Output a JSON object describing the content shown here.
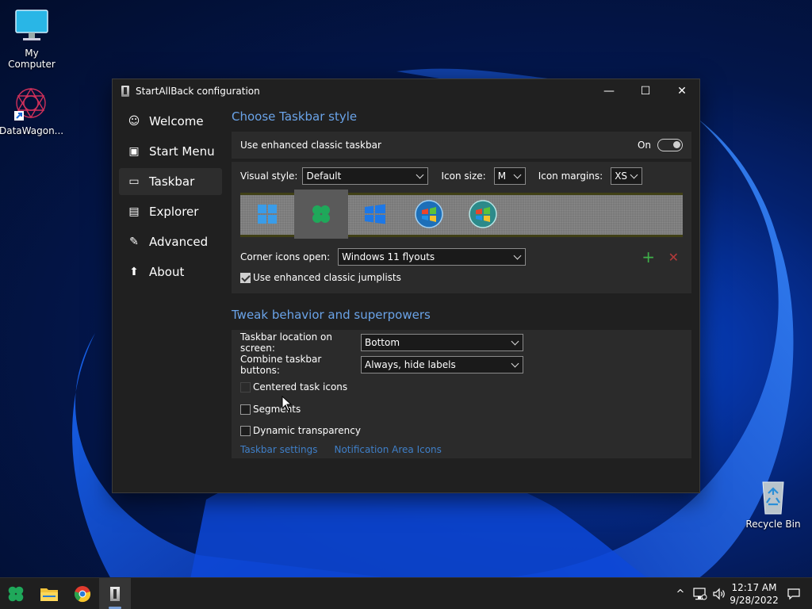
{
  "desktop": {
    "icons": [
      {
        "label": "My Computer"
      },
      {
        "label": "DataWagon..."
      },
      {
        "label": "Recycle Bin"
      }
    ]
  },
  "window": {
    "title": "StartAllBack configuration",
    "controls": {
      "minimize": "—",
      "maximize": "☐",
      "close": "✕"
    }
  },
  "sidebar": {
    "items": [
      {
        "label": "Welcome",
        "icon": "☺"
      },
      {
        "label": "Start Menu",
        "icon": "▣"
      },
      {
        "label": "Taskbar",
        "icon": "▭"
      },
      {
        "label": "Explorer",
        "icon": "▤"
      },
      {
        "label": "Advanced",
        "icon": "✎"
      },
      {
        "label": "About",
        "icon": "⬆"
      }
    ]
  },
  "taskbar_style": {
    "section_title": "Choose Taskbar style",
    "enhanced_label": "Use enhanced classic taskbar",
    "enhanced_state": "On",
    "visual_style_label": "Visual style:",
    "visual_style_value": "Default",
    "icon_size_label": "Icon size:",
    "icon_size_value": "M",
    "icon_margins_label": "Icon margins:",
    "icon_margins_value": "XS",
    "corner_icons_label": "Corner icons open:",
    "corner_icons_value": "Windows 11 flyouts",
    "jumplists_label": "Use enhanced classic jumplists",
    "add_icon": "+",
    "remove_icon": "✕"
  },
  "tweak": {
    "section_title": "Tweak behavior and superpowers",
    "location_label": "Taskbar location on screen:",
    "location_value": "Bottom",
    "combine_label": "Combine taskbar buttons:",
    "combine_value": "Always, hide labels",
    "centered_label": "Centered task icons",
    "segments_label": "Segments",
    "transparency_label": "Dynamic transparency",
    "link_settings": "Taskbar settings",
    "link_notification": "Notification Area Icons"
  },
  "taskbar": {
    "tray_chevron": "^",
    "time": "12:17 AM",
    "date": "9/28/2022"
  },
  "colors": {
    "accent_blue": "#6aa3e8",
    "link_blue": "#3f7fc8",
    "add_green": "#3fb04a",
    "remove_red": "#b33a3a",
    "window_bg": "#202020",
    "panel_bg": "#2b2b2b"
  }
}
